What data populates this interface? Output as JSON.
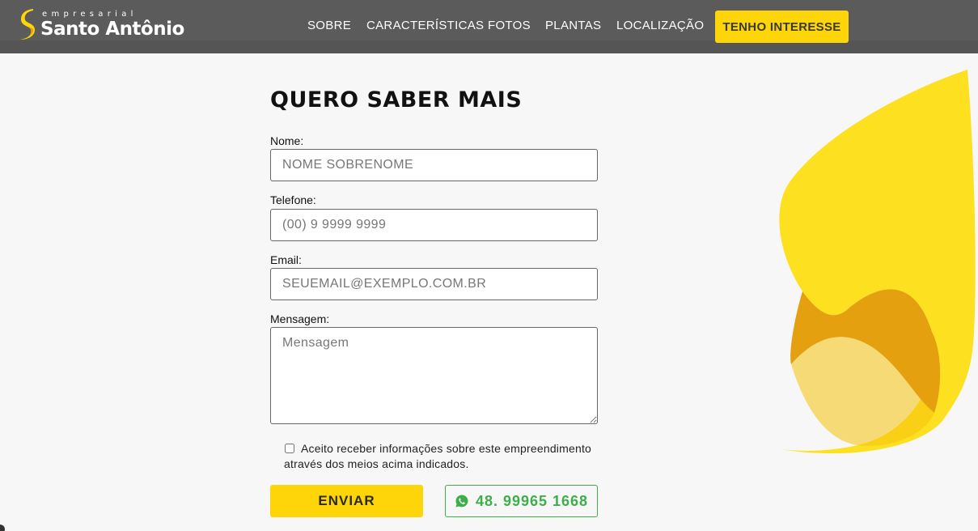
{
  "header": {
    "logo_small": "empresarial",
    "logo_big": "Santo Antônio",
    "nav": [
      "SOBRE",
      "CARACTERÍSTICAS",
      "FOTOS",
      "PLANTAS",
      "LOCALIZAÇÃO"
    ],
    "cta": "TENHO INTERESSE"
  },
  "form": {
    "title": "QUERO SABER MAIS",
    "name_label": "Nome:",
    "name_placeholder": "NOME SOBRENOME",
    "phone_label": "Telefone:",
    "phone_placeholder": "(00) 9 9999 9999",
    "email_label": "Email:",
    "email_placeholder": "SEUEMAIL@EXEMPLO.COM.BR",
    "message_label": "Mensagem:",
    "message_placeholder": "Mensagem",
    "consent_line1": "Aceito receber informações sobre este empreendimento",
    "consent_line2": "através dos meios acima indicados.",
    "submit": "ENVIAR",
    "whatsapp": "48. 99965 1668"
  },
  "colors": {
    "accent": "#fed508",
    "whatsapp": "#3fae49",
    "header_bg": "#555555"
  }
}
